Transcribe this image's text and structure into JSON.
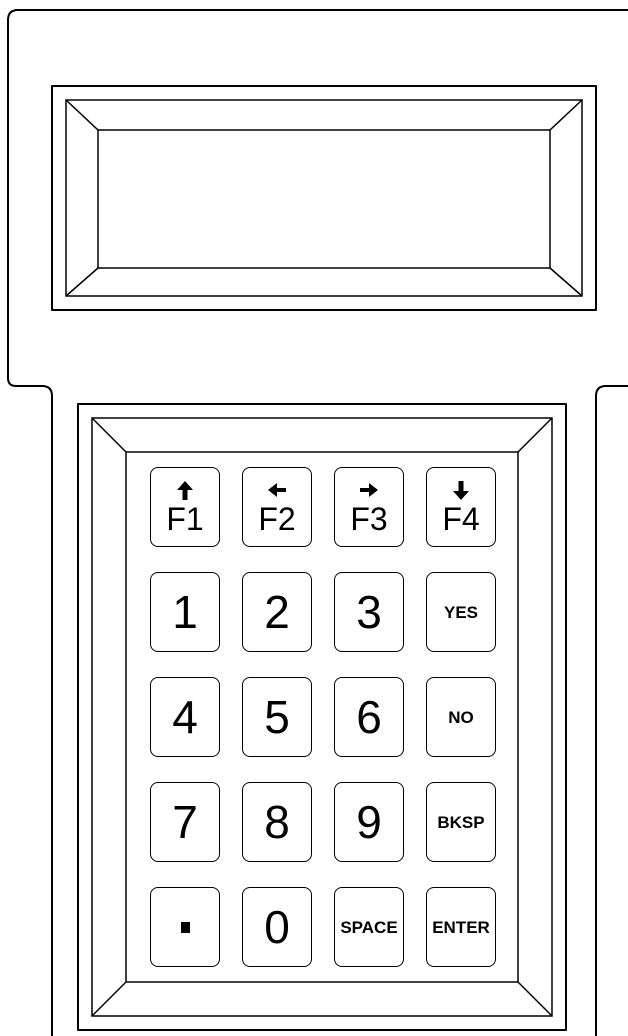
{
  "device": {
    "display_text": ""
  },
  "keypad": {
    "rows": [
      [
        {
          "id": "f1",
          "label": "F1",
          "kind": "function",
          "icon": "arrow-up-icon"
        },
        {
          "id": "f2",
          "label": "F2",
          "kind": "function",
          "icon": "arrow-left-icon"
        },
        {
          "id": "f3",
          "label": "F3",
          "kind": "function",
          "icon": "arrow-right-icon"
        },
        {
          "id": "f4",
          "label": "F4",
          "kind": "function",
          "icon": "arrow-down-icon"
        }
      ],
      [
        {
          "id": "1",
          "label": "1",
          "kind": "digit"
        },
        {
          "id": "2",
          "label": "2",
          "kind": "digit"
        },
        {
          "id": "3",
          "label": "3",
          "kind": "digit"
        },
        {
          "id": "yes",
          "label": "YES",
          "kind": "word"
        }
      ],
      [
        {
          "id": "4",
          "label": "4",
          "kind": "digit"
        },
        {
          "id": "5",
          "label": "5",
          "kind": "digit"
        },
        {
          "id": "6",
          "label": "6",
          "kind": "digit"
        },
        {
          "id": "no",
          "label": "NO",
          "kind": "word"
        }
      ],
      [
        {
          "id": "7",
          "label": "7",
          "kind": "digit"
        },
        {
          "id": "8",
          "label": "8",
          "kind": "digit"
        },
        {
          "id": "9",
          "label": "9",
          "kind": "digit"
        },
        {
          "id": "bksp",
          "label": "BKSP",
          "kind": "word"
        }
      ],
      [
        {
          "id": "decimal",
          "label": ".",
          "kind": "dot",
          "icon": "decimal-point-icon"
        },
        {
          "id": "0",
          "label": "0",
          "kind": "digit"
        },
        {
          "id": "space",
          "label": "SPACE",
          "kind": "word"
        },
        {
          "id": "enter",
          "label": "ENTER",
          "kind": "word"
        }
      ]
    ]
  }
}
